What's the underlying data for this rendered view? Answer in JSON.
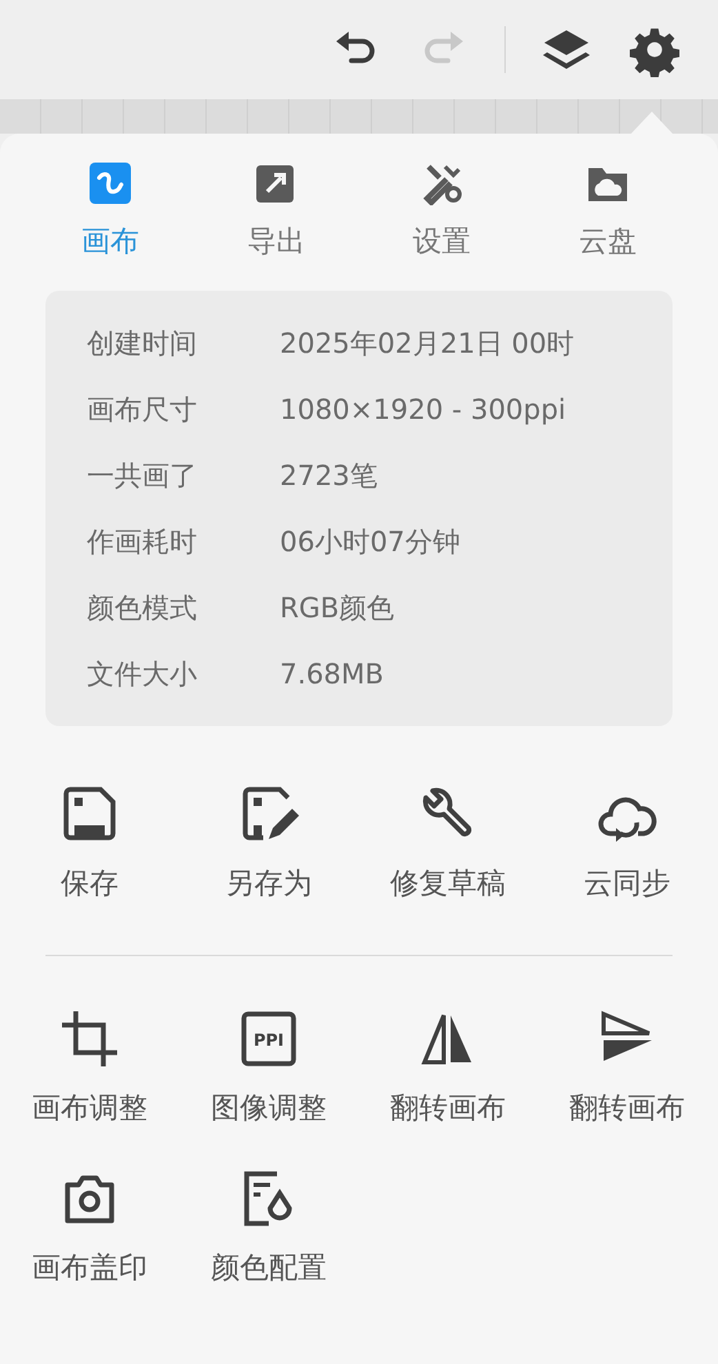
{
  "toolbar": [
    {
      "kind": "undo",
      "disabled": false
    },
    {
      "kind": "redo",
      "disabled": true
    },
    {
      "kind": "layers",
      "disabled": false
    },
    {
      "kind": "settings",
      "disabled": false
    }
  ],
  "tabs": [
    {
      "kind": "canvas",
      "label": "画布",
      "selected": true
    },
    {
      "kind": "export",
      "label": "导出",
      "selected": false
    },
    {
      "kind": "tools",
      "label": "设置",
      "selected": false
    },
    {
      "kind": "cloud",
      "label": "云盘",
      "selected": false
    }
  ],
  "info": [
    {
      "label": "创建时间",
      "value": "2025年02月21日 00时"
    },
    {
      "label": "画布尺寸",
      "value": "1080×1920 - 300ppi"
    },
    {
      "label": "一共画了",
      "value": "2723笔"
    },
    {
      "label": "作画耗时",
      "value": "06小时07分钟"
    },
    {
      "label": "颜色模式",
      "value": "RGB颜色"
    },
    {
      "label": "文件大小",
      "value": "7.68MB"
    }
  ],
  "file_actions": [
    {
      "kind": "save",
      "label": "保存"
    },
    {
      "kind": "save-as",
      "label": "另存为"
    },
    {
      "kind": "repair",
      "label": "修复草稿"
    },
    {
      "kind": "sync",
      "label": "云同步"
    }
  ],
  "canvas_actions": [
    {
      "kind": "crop",
      "label": "画布调整"
    },
    {
      "kind": "ppi",
      "label": "图像调整",
      "icon_text": "PPI"
    },
    {
      "kind": "flip-h",
      "label": "翻转画布"
    },
    {
      "kind": "flip-v",
      "label": "翻转画布"
    },
    {
      "kind": "camera",
      "label": "画布盖印"
    },
    {
      "kind": "color-profile",
      "label": "颜色配置"
    }
  ]
}
